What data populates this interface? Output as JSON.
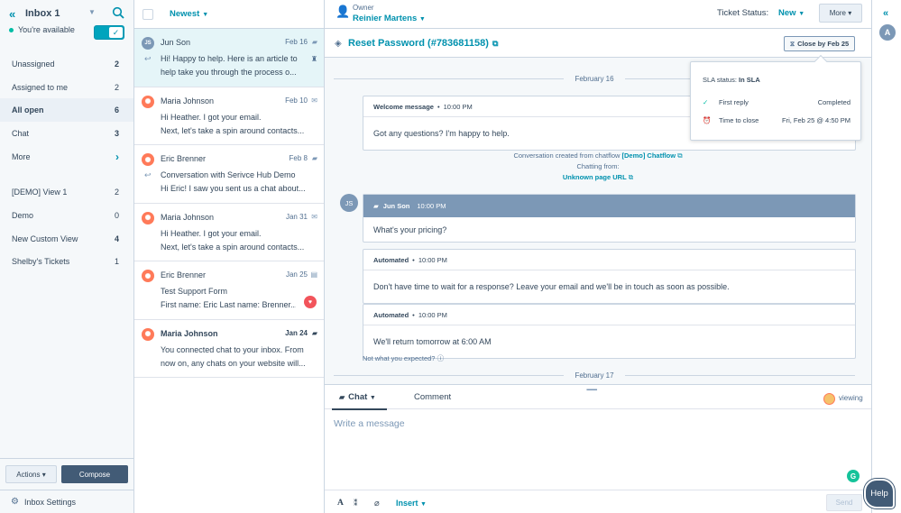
{
  "sidebar": {
    "collapse_icon": "double-chevron-left-icon",
    "title": "Inbox 1",
    "availability": "You're available",
    "items": [
      {
        "label": "Unassigned",
        "count": "2"
      },
      {
        "label": "Assigned to me",
        "count": "2"
      },
      {
        "label": "All open",
        "count": "6"
      },
      {
        "label": "Chat",
        "count": "3"
      },
      {
        "label": "More",
        "count": "›"
      },
      {
        "label": "[DEMO] View 1",
        "count": "2"
      },
      {
        "label": "Demo",
        "count": "0"
      },
      {
        "label": "New Custom View",
        "count": "4"
      },
      {
        "label": "Shelby's Tickets",
        "count": "1"
      }
    ],
    "actions_label": "Actions ▾",
    "compose_label": "Compose",
    "settings_label": "Inbox Settings"
  },
  "list": {
    "sort_label": "Newest",
    "conversations": [
      {
        "initials": "JS",
        "name": "Jun Son",
        "date": "Feb 16",
        "line1": "Hi! Happy to help. Here is an article to",
        "line2": "help take you through the process o..."
      },
      {
        "initials": "",
        "name": "Maria Johnson",
        "date": "Feb 10",
        "line1": "Hi Heather. I got your email.",
        "line2": "Next, let's take a spin around contacts..."
      },
      {
        "initials": "",
        "name": "Eric Brenner",
        "date": "Feb 8",
        "line1": "Conversation with Serivce Hub Demo",
        "line2": "Hi Eric! I saw you sent us a chat about..."
      },
      {
        "initials": "",
        "name": "Maria Johnson",
        "date": "Jan 31",
        "line1": "Hi Heather. I got your email.",
        "line2": "Next, let's take a spin around contacts..."
      },
      {
        "initials": "",
        "name": "Eric Brenner",
        "date": "Jan 25",
        "line1": "Test Support Form",
        "line2": "First name: Eric Last name: Brenner..."
      },
      {
        "initials": "",
        "name": "Maria Johnson",
        "date": "Jan 24",
        "line1": "You connected chat to your inbox. From",
        "line2": "now on, any chats on your website will..."
      }
    ]
  },
  "topbar": {
    "owner_label": "Owner",
    "owner_value": "Reinier Martens",
    "ticket_status_label": "Ticket Status:",
    "ticket_status_value": "New",
    "more_label": "More ▾"
  },
  "ticket": {
    "title": "Reset Password (#783681158)",
    "close_by": "Close by Feb 25"
  },
  "thread": {
    "date1": "February 16",
    "welcome": {
      "label": "Welcome message",
      "time": "10:00 PM",
      "body": "Got any questions? I'm happy to help."
    },
    "created_text": "Conversation created from chatflow",
    "chatflow_link": "[Demo] Chatflow",
    "chatting_from": "Chatting from:",
    "page_link": "Unknown page URL",
    "user_initials": "JS",
    "user_msg": {
      "label": "Jun Son",
      "time": "10:00 PM",
      "body": "What's your pricing?"
    },
    "auto1": {
      "label": "Automated",
      "time": "10:00 PM",
      "body": "Don't have time to wait for a response? Leave your email and we'll be in touch as soon as possible."
    },
    "auto2": {
      "label": "Automated",
      "time": "10:00 PM",
      "body": "We'll return tomorrow at 6:00 AM"
    },
    "not_expected": "Not what you expected?",
    "date2": "February 17"
  },
  "sla": {
    "status_label": "SLA status:",
    "status_value": "In SLA",
    "rows": [
      {
        "label": "First reply",
        "value": "Completed"
      },
      {
        "label": "Time to close",
        "value": "Fri, Feb 25 @ 4:50 PM"
      }
    ]
  },
  "composer": {
    "tab_chat": "Chat",
    "tab_comment": "Comment",
    "viewing": "viewing",
    "placeholder": "Write a message",
    "insert_label": "Insert",
    "send_label": "Send"
  },
  "rail": {
    "avatar_initial": "A"
  },
  "help_label": "Help"
}
